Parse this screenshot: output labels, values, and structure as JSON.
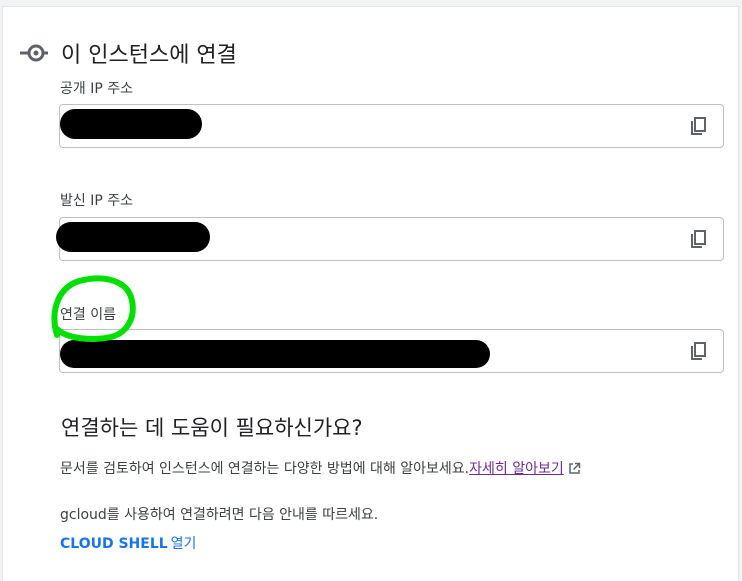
{
  "header": {
    "title": "이 인스턴스에 연결",
    "icon": "connect-icon"
  },
  "fields": [
    {
      "label": "공개 IP 주소",
      "value": ""
    },
    {
      "label": "발신 IP 주소",
      "value": ""
    },
    {
      "label": "연결 이름",
      "value": ""
    }
  ],
  "help": {
    "heading": "연결하는 데 도움이 필요하신가요?",
    "doc_text": "문서를 검토하여 인스턴스에 연결하는 다양한 방법에 대해 알아보세요.",
    "learn_more": "자세히 알아보기",
    "gcloud_text": "gcloud를 사용하여 연결하려면 다음 안내를 따르세요.",
    "cloud_shell_bold": "CLOUD SHELL",
    "cloud_shell_rest": "열기"
  },
  "colors": {
    "link": "#1a73e8",
    "visited_link": "#6b2c91",
    "highlight": "#00e000",
    "redaction": "#000000"
  }
}
